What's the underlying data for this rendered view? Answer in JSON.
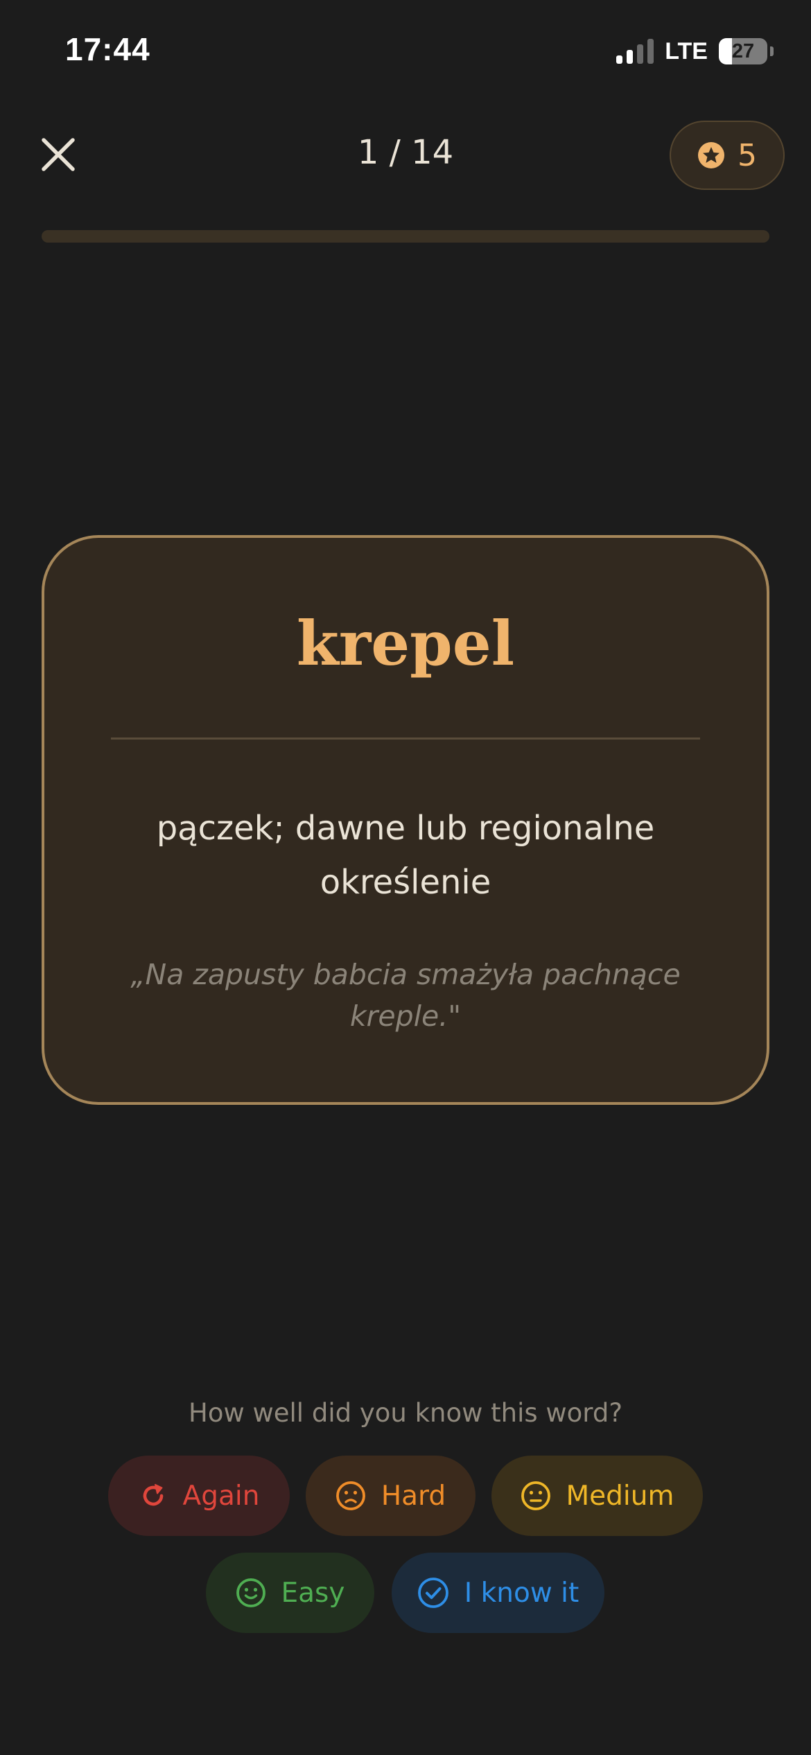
{
  "status_bar": {
    "time": "17:44",
    "network": "LTE",
    "battery_percent": "27",
    "battery_level": 0.27,
    "signal_bars_active": 2,
    "signal_bars_total": 4
  },
  "header": {
    "close_icon": "close-icon",
    "counter": "1 / 14",
    "xp_icon": "star-coin-icon",
    "xp_value": "5"
  },
  "progress": {
    "current": 1,
    "total": 14,
    "fraction": 0
  },
  "card": {
    "word": "krepel",
    "definition": "pączek; dawne lub regionalne określenie",
    "example": "„Na zapusty babcia smażyła pachnące kreple.\""
  },
  "rating": {
    "prompt": "How well did you know this word?",
    "buttons": [
      {
        "label": "Again",
        "icon": "refresh-icon",
        "color": "#e0463c"
      },
      {
        "label": "Hard",
        "icon": "frown-face-icon",
        "color": "#f08d29"
      },
      {
        "label": "Medium",
        "icon": "neutral-face-icon",
        "color": "#efb728"
      },
      {
        "label": "Easy",
        "icon": "smile-face-icon",
        "color": "#4fae52"
      },
      {
        "label": "I know it",
        "icon": "check-circle-icon",
        "color": "#2e8ee6"
      }
    ]
  },
  "colors": {
    "background": "#1c1c1c",
    "accent": "#f0b46c",
    "card_background": "#32291f",
    "card_border": "#a58659"
  }
}
